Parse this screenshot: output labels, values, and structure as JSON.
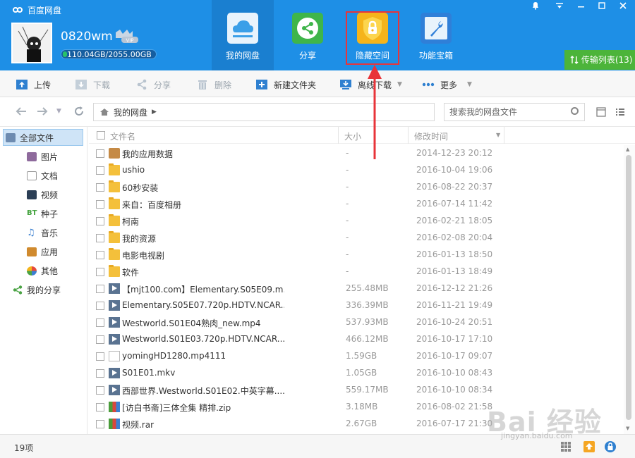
{
  "app": {
    "title": "百度网盘"
  },
  "user": {
    "name": "0820wm",
    "vip": "VIP",
    "quota": "110.04GB/2055.00GB"
  },
  "nav": [
    {
      "label": "我的网盘",
      "icon": "cloud-icon",
      "color": "#e8f3fc"
    },
    {
      "label": "分享",
      "icon": "share-icon",
      "color": "#3fb54a"
    },
    {
      "label": "隐藏空间",
      "icon": "lock-shield-icon",
      "color": "#f5b41b"
    },
    {
      "label": "功能宝箱",
      "icon": "wrench-icon",
      "color": "#2f7fd8"
    }
  ],
  "transfer": {
    "label": "传输列表(13)"
  },
  "toolbar": {
    "upload": "上传",
    "download": "下载",
    "share": "分享",
    "delete": "删除",
    "new_folder": "新建文件夹",
    "offline": "离线下载",
    "more": "更多"
  },
  "address": {
    "path": "我的网盘",
    "search_placeholder": "搜索我的网盘文件"
  },
  "sidebar": [
    {
      "label": "全部文件",
      "icon": "all-files-icon"
    },
    {
      "label": "图片",
      "icon": "picture-icon"
    },
    {
      "label": "文档",
      "icon": "document-icon"
    },
    {
      "label": "视频",
      "icon": "video-icon"
    },
    {
      "label": "种子",
      "icon": "bt-icon"
    },
    {
      "label": "音乐",
      "icon": "music-icon"
    },
    {
      "label": "应用",
      "icon": "app-icon"
    },
    {
      "label": "其他",
      "icon": "other-icon"
    },
    {
      "label": "我的分享",
      "icon": "my-share-icon"
    }
  ],
  "columns": {
    "name": "文件名",
    "size": "大小",
    "date": "修改时间"
  },
  "files": [
    {
      "name": "我的应用数据",
      "size": "-",
      "date": "2014-12-23 20:12",
      "type": "appdata"
    },
    {
      "name": "ushio",
      "size": "-",
      "date": "2016-10-04 19:06",
      "type": "folder"
    },
    {
      "name": "60秒安装",
      "size": "-",
      "date": "2016-08-22 20:37",
      "type": "folder"
    },
    {
      "name": "来自：百度相册",
      "size": "-",
      "date": "2016-07-14 11:42",
      "type": "folder"
    },
    {
      "name": "柯南",
      "size": "-",
      "date": "2016-02-21 18:05",
      "type": "folder"
    },
    {
      "name": "我的资源",
      "size": "-",
      "date": "2016-02-08 20:04",
      "type": "folder"
    },
    {
      "name": "电影电视剧",
      "size": "-",
      "date": "2016-01-13 18:50",
      "type": "folder"
    },
    {
      "name": "软件",
      "size": "-",
      "date": "2016-01-13 18:49",
      "type": "folder"
    },
    {
      "name": "【mjt100.com】Elementary.S05E09.m...",
      "size": "255.48MB",
      "date": "2016-12-12 21:26",
      "type": "video"
    },
    {
      "name": "Elementary.S05E07.720p.HDTV.NCAR...",
      "size": "336.39MB",
      "date": "2016-11-21 19:49",
      "type": "video"
    },
    {
      "name": "Westworld.S01E04熟肉_new.mp4",
      "size": "537.93MB",
      "date": "2016-10-24 20:51",
      "type": "video"
    },
    {
      "name": "Westworld.S01E03.720p.HDTV.NCAR...",
      "size": "466.12MB",
      "date": "2016-10-17 17:10",
      "type": "video"
    },
    {
      "name": "yomingHD1280.mp4111",
      "size": "1.59GB",
      "date": "2016-10-17 09:07",
      "type": "cloud"
    },
    {
      "name": "S01E01.mkv",
      "size": "1.05GB",
      "date": "2016-10-10 08:43",
      "type": "video"
    },
    {
      "name": "西部世界.Westworld.S01E02.中英字幕....",
      "size": "559.17MB",
      "date": "2016-10-10 08:34",
      "type": "video"
    },
    {
      "name": "[访白书斋]三体全集 精排.zip",
      "size": "3.18MB",
      "date": "2016-08-02 21:58",
      "type": "zip"
    },
    {
      "name": "视频.rar",
      "size": "2.67GB",
      "date": "2016-07-17 21:30",
      "type": "zip"
    }
  ],
  "status": {
    "count": "19项"
  },
  "watermark": {
    "main": "Bai 经验",
    "sub": "jingyan.baidu.com"
  }
}
